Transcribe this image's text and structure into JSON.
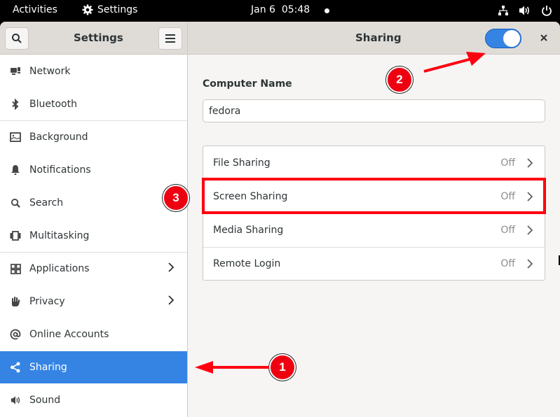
{
  "topbar": {
    "activities": "Activities",
    "app_name": "Settings",
    "clock": "Jan 6  05:48",
    "tray_icons": [
      "network-wired-icon",
      "volume-icon",
      "power-icon"
    ]
  },
  "headerbar": {
    "sidebar_title": "Settings",
    "page_title": "Sharing",
    "sharing_enabled": true
  },
  "sidebar": {
    "items": [
      {
        "label": "Network",
        "icon": "network-icon",
        "has_chevron": false,
        "active": false
      },
      {
        "label": "Bluetooth",
        "icon": "bluetooth-icon",
        "has_chevron": false,
        "active": false
      },
      {
        "label": "Background",
        "icon": "image-icon",
        "has_chevron": false,
        "active": false
      },
      {
        "label": "Notifications",
        "icon": "bell-icon",
        "has_chevron": false,
        "active": false
      },
      {
        "label": "Search",
        "icon": "search-icon",
        "has_chevron": false,
        "active": false
      },
      {
        "label": "Multitasking",
        "icon": "multitasking-icon",
        "has_chevron": false,
        "active": false
      },
      {
        "label": "Applications",
        "icon": "grid-icon",
        "has_chevron": true,
        "active": false
      },
      {
        "label": "Privacy",
        "icon": "hand-icon",
        "has_chevron": true,
        "active": false
      },
      {
        "label": "Online Accounts",
        "icon": "at-icon",
        "has_chevron": false,
        "active": false
      },
      {
        "label": "Sharing",
        "icon": "share-icon",
        "has_chevron": false,
        "active": true
      },
      {
        "label": "Sound",
        "icon": "speaker-icon",
        "has_chevron": false,
        "active": false
      }
    ]
  },
  "content": {
    "computer_name_label": "Computer Name",
    "computer_name_value": "fedora",
    "rows": [
      {
        "label": "File Sharing",
        "value": "Off"
      },
      {
        "label": "Screen Sharing",
        "value": "Off"
      },
      {
        "label": "Media Sharing",
        "value": "Off"
      },
      {
        "label": "Remote Login",
        "value": "Off"
      }
    ]
  },
  "annotations": {
    "badges": [
      "1",
      "2",
      "3"
    ],
    "color": "#ff0010"
  },
  "colors": {
    "accent": "#3584e4",
    "headerbar": "#dfdcd8",
    "window_bg": "#f6f5f4"
  }
}
